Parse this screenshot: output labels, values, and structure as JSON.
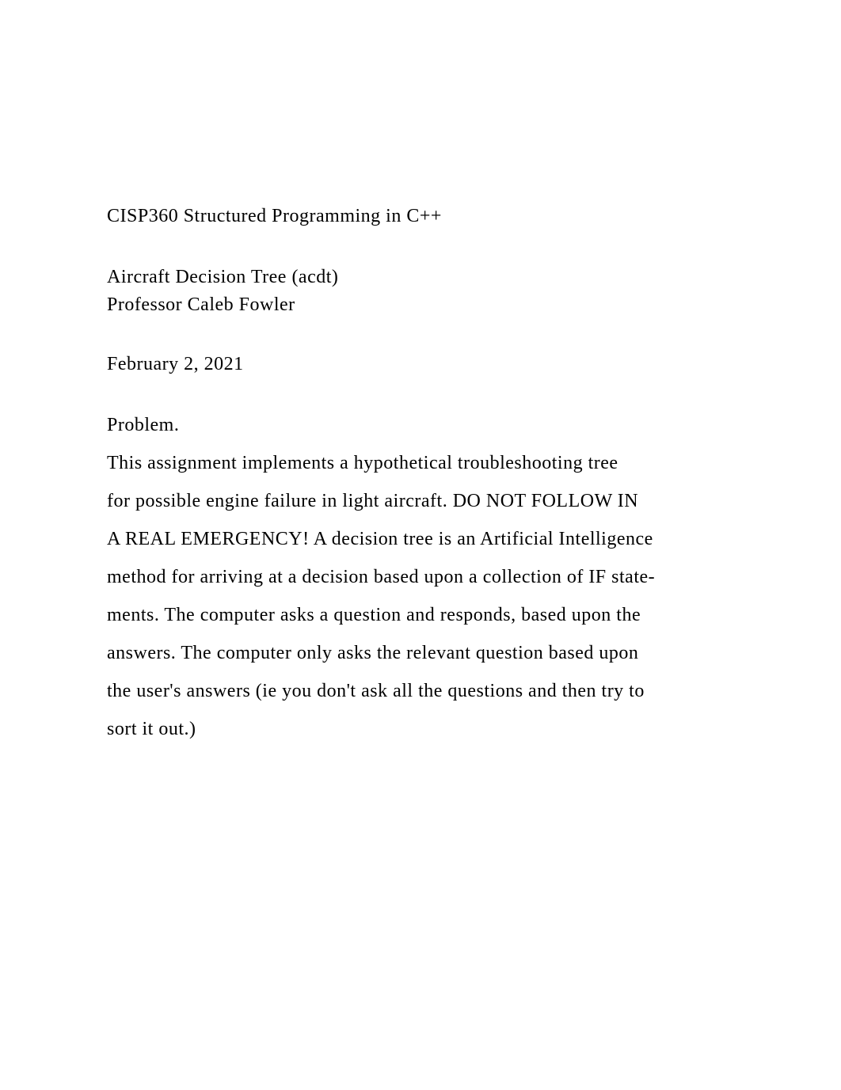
{
  "course": "CISP360 Structured Programming in C++",
  "assignment": "Aircraft Decision Tree (acdt)",
  "professor": "Professor Caleb Fowler",
  "date": "February 2, 2021",
  "section_heading": "Problem.",
  "body": {
    "line1": "This assignment implements a hypothetical troubleshooting tree",
    "line2": "for possible engine failure in light aircraft. DO NOT FOLLOW IN",
    "line3": "A REAL EMERGENCY! A decision tree is an Artificial Intelligence",
    "line4": "method for arriving at a decision based upon a collection of IF state-",
    "line5": "ments. The computer asks a question and responds, based upon the",
    "line6": "answers. The computer only asks the relevant question based upon",
    "line7": "the user's answers (ie you don't ask all the questions and then try to",
    "line8": "sort it out.)"
  }
}
